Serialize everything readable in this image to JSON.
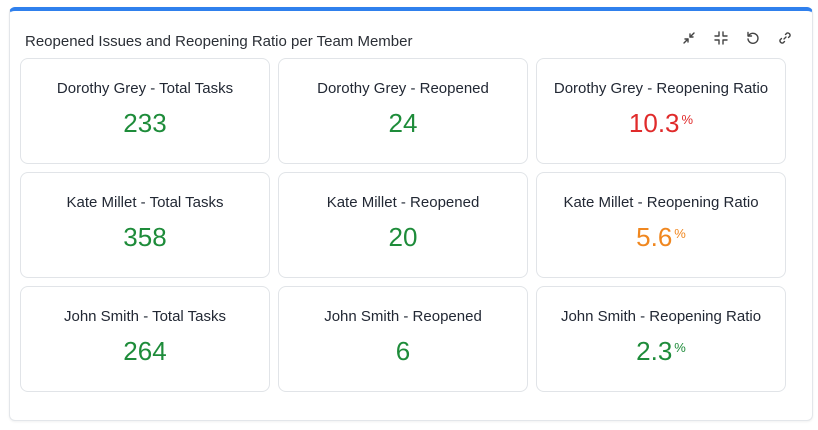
{
  "panel": {
    "title": "Reopened Issues and Reopening Ratio per Team Member",
    "actions": [
      {
        "icon": "shrink-arrows-icon"
      },
      {
        "icon": "collapse-icon"
      },
      {
        "icon": "refresh-icon"
      },
      {
        "icon": "link-icon"
      }
    ]
  },
  "colors": {
    "green": "#1e8c3a",
    "red": "#e02b2b",
    "orange": "#f0871f",
    "accent": "#2f80ed"
  },
  "cards": [
    {
      "label": "Dorothy Grey - Total Tasks",
      "value": "233",
      "unit": "",
      "color": "#1e8c3a"
    },
    {
      "label": "Dorothy Grey - Reopened",
      "value": "24",
      "unit": "",
      "color": "#1e8c3a"
    },
    {
      "label": "Dorothy Grey - Reopening Ratio",
      "value": "10.3",
      "unit": "%",
      "color": "#e02b2b"
    },
    {
      "label": "Kate Millet - Total Tasks",
      "value": "358",
      "unit": "",
      "color": "#1e8c3a"
    },
    {
      "label": "Kate Millet - Reopened",
      "value": "20",
      "unit": "",
      "color": "#1e8c3a"
    },
    {
      "label": "Kate Millet - Reopening Ratio",
      "value": "5.6",
      "unit": "%",
      "color": "#f0871f"
    },
    {
      "label": "John Smith - Total Tasks",
      "value": "264",
      "unit": "",
      "color": "#1e8c3a"
    },
    {
      "label": "John Smith - Reopened",
      "value": "6",
      "unit": "",
      "color": "#1e8c3a"
    },
    {
      "label": "John Smith - Reopening Ratio",
      "value": "2.3",
      "unit": "%",
      "color": "#1e8c3a"
    }
  ]
}
